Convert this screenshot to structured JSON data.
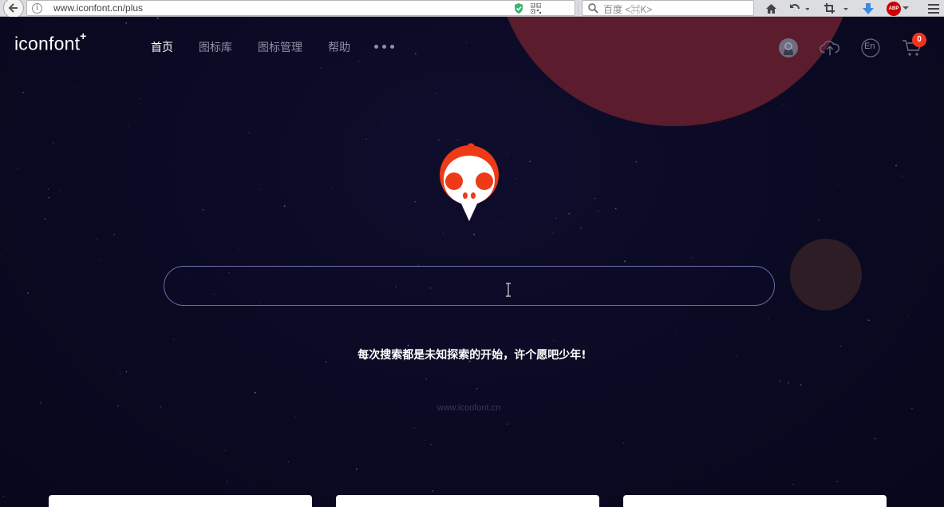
{
  "browser": {
    "url": "www.iconfont.cn/plus",
    "search_placeholder": "百度 <⌘K>",
    "abp_label": "ABP"
  },
  "header": {
    "logo": "iconfont",
    "logo_plus": "+",
    "nav": [
      {
        "label": "首页",
        "active": true
      },
      {
        "label": "图标库",
        "active": false
      },
      {
        "label": "图标管理",
        "active": false
      },
      {
        "label": "帮助",
        "active": false
      }
    ],
    "icons": [
      "user-avatar-icon",
      "upload-cloud-icon",
      "language-en-icon",
      "cart-icon"
    ],
    "language_label": "En",
    "cart_count": "0"
  },
  "hero": {
    "search_value": "",
    "slogan": "每次搜索都是未知探索的开始，许个愿吧少年!",
    "watermark": "www.iconfont.cn"
  },
  "colors": {
    "background": "#0b0a24",
    "planet": "#5b1c2e",
    "accent_red": "#f2331f",
    "search_border": "#6b6fa8"
  },
  "cards": [
    "card-1",
    "card-2",
    "card-3"
  ]
}
